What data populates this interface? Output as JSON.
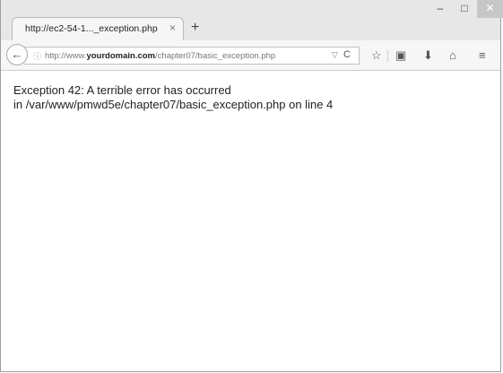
{
  "tab": {
    "title": "http://ec2-54-1..._exception.php",
    "close": "×",
    "new_tab": "+"
  },
  "window_controls": {
    "minimize": "–",
    "maximize": "□",
    "close": "✕"
  },
  "navbar": {
    "url_prefix": "http://www.",
    "url_domain": "yourdomain.com",
    "url_path": "/chapter07/basic_exception.php",
    "back_icon": "←",
    "lock_icon": "ⓘ",
    "dropdown_icon": "▽",
    "reload_icon": "C",
    "bookmark_icon": "☆",
    "reader_icon": "▣",
    "download_icon": "⬇",
    "home_icon": "⌂",
    "menu_icon": "≡"
  },
  "page": {
    "line1": "Exception 42: A terrible error has occurred",
    "line2": "in /var/www/pmwd5e/chapter07/basic_exception.php on line 4"
  }
}
